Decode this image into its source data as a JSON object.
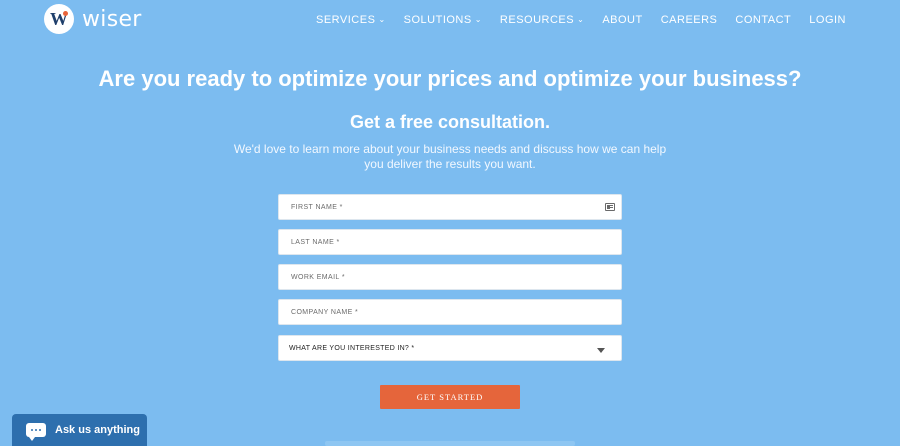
{
  "header": {
    "logo_initial": "W",
    "logo_text": "wiser",
    "nav": [
      {
        "label": "SERVICES",
        "has_dropdown": true
      },
      {
        "label": "SOLUTIONS",
        "has_dropdown": true
      },
      {
        "label": "RESOURCES",
        "has_dropdown": true
      },
      {
        "label": "ABOUT",
        "has_dropdown": false
      },
      {
        "label": "CAREERS",
        "has_dropdown": false
      },
      {
        "label": "CONTACT",
        "has_dropdown": false
      },
      {
        "label": "LOGIN",
        "has_dropdown": false
      }
    ]
  },
  "hero": {
    "headline": "Are you ready to optimize your prices and optimize your business?",
    "subhead": "Get a free consultation.",
    "intro_line1": "We'd love to learn more about your business needs and discuss how we can help",
    "intro_line2": "you deliver the results you want."
  },
  "form": {
    "first_name_placeholder": "FIRST NAME *",
    "last_name_placeholder": "LAST NAME *",
    "work_email_placeholder": "WORK EMAIL *",
    "company_name_placeholder": "COMPANY NAME *",
    "interest_select": "WHAT ARE YOU INTERESTED IN? *",
    "submit_label": "GET STARTED"
  },
  "chat": {
    "label": "Ask us anything"
  },
  "colors": {
    "background": "#7cbcf0",
    "accent_button": "#e5653b",
    "chat_widget": "#2d6fae",
    "logo_dark": "#1f3f6b"
  },
  "icons": [
    "chevron-down-icon",
    "contact-card-icon",
    "caret-down-icon",
    "chat-bubble-icon"
  ]
}
